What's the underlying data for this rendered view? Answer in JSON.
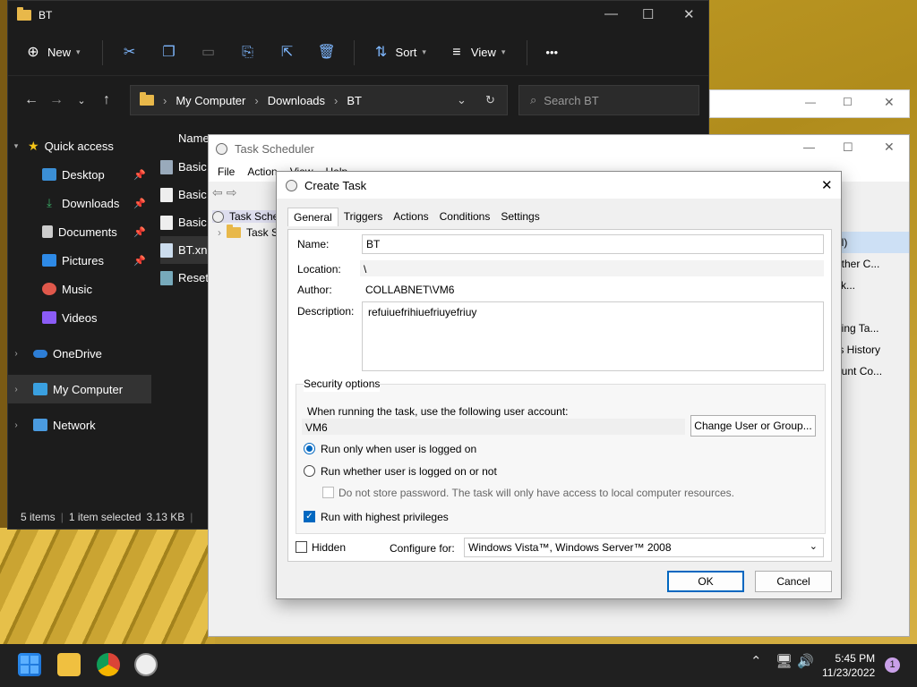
{
  "explorer": {
    "title": "BT",
    "cmd": {
      "new": "New",
      "sort": "Sort",
      "view": "View",
      "more": "•••"
    },
    "address": [
      "My Computer",
      "Downloads",
      "BT"
    ],
    "search_placeholder": "Search BT",
    "col_name": "Name",
    "nav": {
      "quick_access": "Quick access",
      "desktop": "Desktop",
      "downloads": "Downloads",
      "documents": "Documents",
      "pictures": "Pictures",
      "music": "Music",
      "videos": "Videos",
      "onedrive": "OneDrive",
      "mycomputer": "My Computer",
      "network": "Network"
    },
    "files": [
      "Basic",
      "Basic",
      "Basic",
      "BT.xn",
      "Reset"
    ],
    "status": {
      "items": "5 items",
      "selected": "1 item selected",
      "size": "3.13 KB"
    }
  },
  "scheduler": {
    "title": "Task Scheduler",
    "menu": [
      "File",
      "Action",
      "View",
      "Help"
    ],
    "tree": [
      "Task Sche",
      "Task S"
    ],
    "right_pane": [
      "al)",
      "other C...",
      "sk...",
      "",
      "ning Ta...",
      "ts History",
      "ount Co..."
    ]
  },
  "dialog": {
    "title": "Create Task",
    "tabs": [
      "General",
      "Triggers",
      "Actions",
      "Conditions",
      "Settings"
    ],
    "name_label": "Name:",
    "name_value": "BT",
    "location_label": "Location:",
    "location_value": "\\",
    "author_label": "Author:",
    "author_value": "COLLABNET\\VM6",
    "description_label": "Description:",
    "description_value": "refuiuefrihiuefriuyefriuy",
    "security_title": "Security options",
    "security_prompt": "When running the task, use the following user account:",
    "user_account": "VM6",
    "change_user_button": "Change User or Group...",
    "radio_logged_on": "Run only when user is logged on",
    "radio_whether": "Run whether user is logged on or not",
    "dont_store": "Do not store password.  The task will only have access to local computer resources.",
    "highest_priv": "Run with highest privileges",
    "hidden": "Hidden",
    "configure_label": "Configure for:",
    "configure_value": "Windows Vista™, Windows Server™ 2008",
    "ok": "OK",
    "cancel": "Cancel"
  },
  "taskbar": {
    "time": "5:45 PM",
    "date": "11/23/2022",
    "badge": "1"
  }
}
